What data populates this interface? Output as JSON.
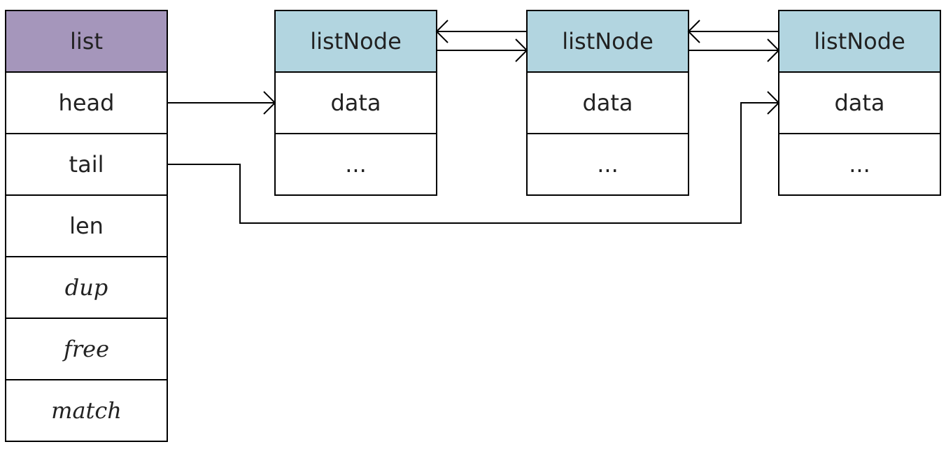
{
  "colors": {
    "list_header": "#A596BB",
    "node_header": "#B2D5E0"
  },
  "list": {
    "title": "list",
    "fields": [
      {
        "label": "head",
        "italic": false
      },
      {
        "label": "tail",
        "italic": false
      },
      {
        "label": "len",
        "italic": false
      },
      {
        "label": "dup",
        "italic": true
      },
      {
        "label": "free",
        "italic": true
      },
      {
        "label": "match",
        "italic": true
      }
    ]
  },
  "nodes": [
    {
      "title": "listNode",
      "fields": [
        "data",
        "..."
      ]
    },
    {
      "title": "listNode",
      "fields": [
        "data",
        "..."
      ]
    },
    {
      "title": "listNode",
      "fields": [
        "data",
        "..."
      ]
    }
  ],
  "edges": [
    {
      "from": "list.head",
      "to": "nodes.0",
      "label": ""
    },
    {
      "from": "list.tail",
      "to": "nodes.2",
      "label": ""
    },
    {
      "from": "nodes.0",
      "to": "nodes.1",
      "type": "next"
    },
    {
      "from": "nodes.1",
      "to": "nodes.0",
      "type": "prev"
    },
    {
      "from": "nodes.1",
      "to": "nodes.2",
      "type": "next"
    },
    {
      "from": "nodes.2",
      "to": "nodes.1",
      "type": "prev"
    }
  ]
}
